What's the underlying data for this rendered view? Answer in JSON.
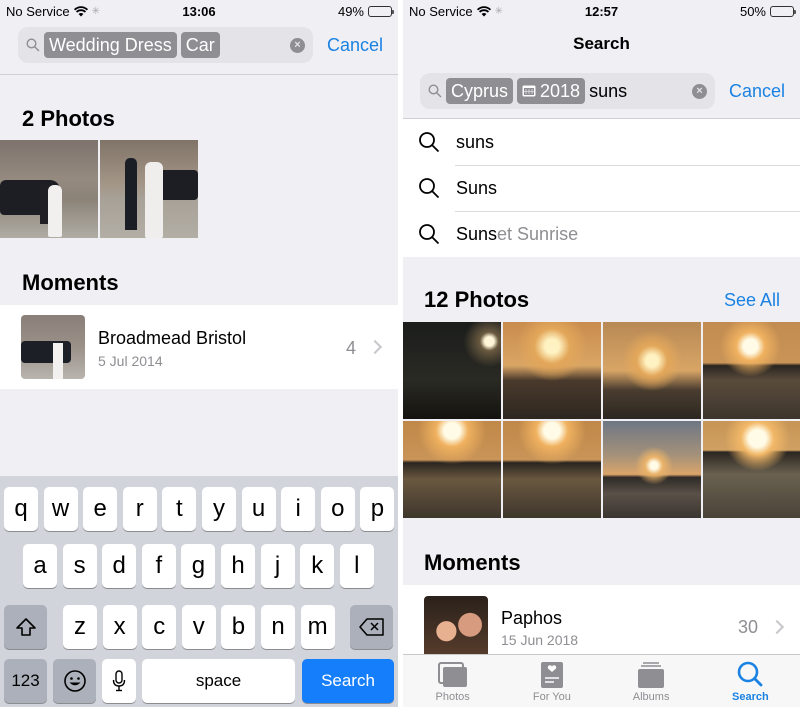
{
  "left": {
    "status": {
      "carrier": "No Service",
      "time": "13:06",
      "battery": "49%",
      "battery_level": 0.49
    },
    "search": {
      "tokens": [
        "Wedding Dress",
        "Car"
      ],
      "typed": "",
      "cancel_label": "Cancel"
    },
    "photos_section": {
      "title": "2 Photos",
      "photos": [
        "wedding-car-photo-1",
        "wedding-car-photo-2"
      ]
    },
    "moments_section": {
      "title": "Moments",
      "items": [
        {
          "title": "Broadmead Bristol",
          "date": "5 Jul 2014",
          "count": "4"
        }
      ]
    },
    "keyboard": {
      "row1": [
        "q",
        "w",
        "e",
        "r",
        "t",
        "y",
        "u",
        "i",
        "o",
        "p"
      ],
      "row2": [
        "a",
        "s",
        "d",
        "f",
        "g",
        "h",
        "j",
        "k",
        "l"
      ],
      "row3": [
        "z",
        "x",
        "c",
        "v",
        "b",
        "n",
        "m"
      ],
      "numbers_label": "123",
      "space_label": "space",
      "action_label": "Search"
    }
  },
  "right": {
    "status": {
      "carrier": "No Service",
      "time": "12:57",
      "battery": "50%",
      "battery_level": 0.5
    },
    "nav_title": "Search",
    "search": {
      "tokens": [
        "Cyprus",
        "2018"
      ],
      "typed": "suns",
      "cancel_label": "Cancel"
    },
    "suggestions": [
      {
        "match": "suns",
        "rest": ""
      },
      {
        "match": "Suns",
        "rest": ""
      },
      {
        "match": "Suns",
        "rest": "et Sunrise"
      }
    ],
    "photos_section": {
      "title": "12 Photos",
      "see_all_label": "See All"
    },
    "moments_section": {
      "title": "Moments",
      "items": [
        {
          "title": "Paphos",
          "date": "15 Jun 2018",
          "count": "30"
        }
      ]
    },
    "tabbar": [
      {
        "label": "Photos",
        "icon": "photos-icon",
        "active": false
      },
      {
        "label": "For You",
        "icon": "for-you-icon",
        "active": false
      },
      {
        "label": "Albums",
        "icon": "albums-icon",
        "active": false
      },
      {
        "label": "Search",
        "icon": "search-icon",
        "active": true
      }
    ]
  },
  "colors": {
    "accent": "#1a82e2",
    "keyboard_action": "#157efb",
    "background": "#efeff4"
  }
}
